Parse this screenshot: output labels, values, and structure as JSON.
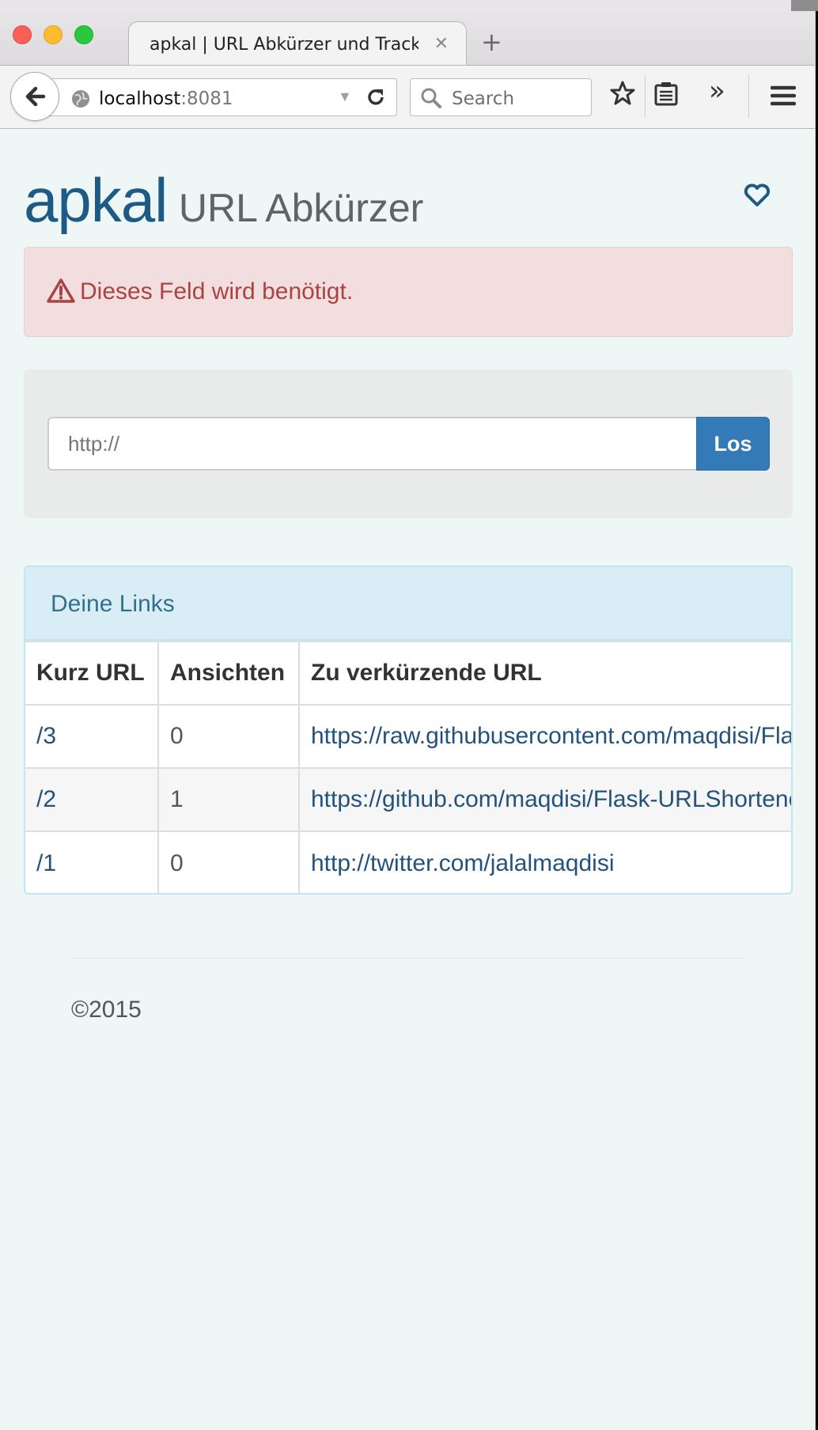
{
  "browser": {
    "tab_title": "apkal | URL Abkürzer und Tracki…",
    "url_host": "localhost",
    "url_port": ":8081",
    "search_placeholder": "Search"
  },
  "header": {
    "brand": "apkal",
    "subtitle": "URL Abkürzer"
  },
  "alert": {
    "message": "Dieses Feld wird benötigt."
  },
  "form": {
    "url_placeholder": "http://",
    "submit_label": "Los"
  },
  "links_panel": {
    "title": "Deine Links",
    "columns": [
      "Kurz URL",
      "Ansichten",
      "Zu verkürzende URL"
    ],
    "rows": [
      {
        "short": "/3",
        "views": "0",
        "target": "https://raw.githubusercontent.com/maqdisi/Flask-URLShortener"
      },
      {
        "short": "/2",
        "views": "1",
        "target": "https://github.com/maqdisi/Flask-URLShortener"
      },
      {
        "short": "/1",
        "views": "0",
        "target": "http://twitter.com/jalalmaqdisi"
      }
    ]
  },
  "footer": {
    "copyright": "©2015"
  },
  "colors": {
    "brand": "#1e5a86",
    "alert_bg": "#f2dede",
    "alert_text": "#a94442",
    "button": "#337ab7",
    "panel_head": "#d9edf7",
    "link": "#23527c"
  }
}
